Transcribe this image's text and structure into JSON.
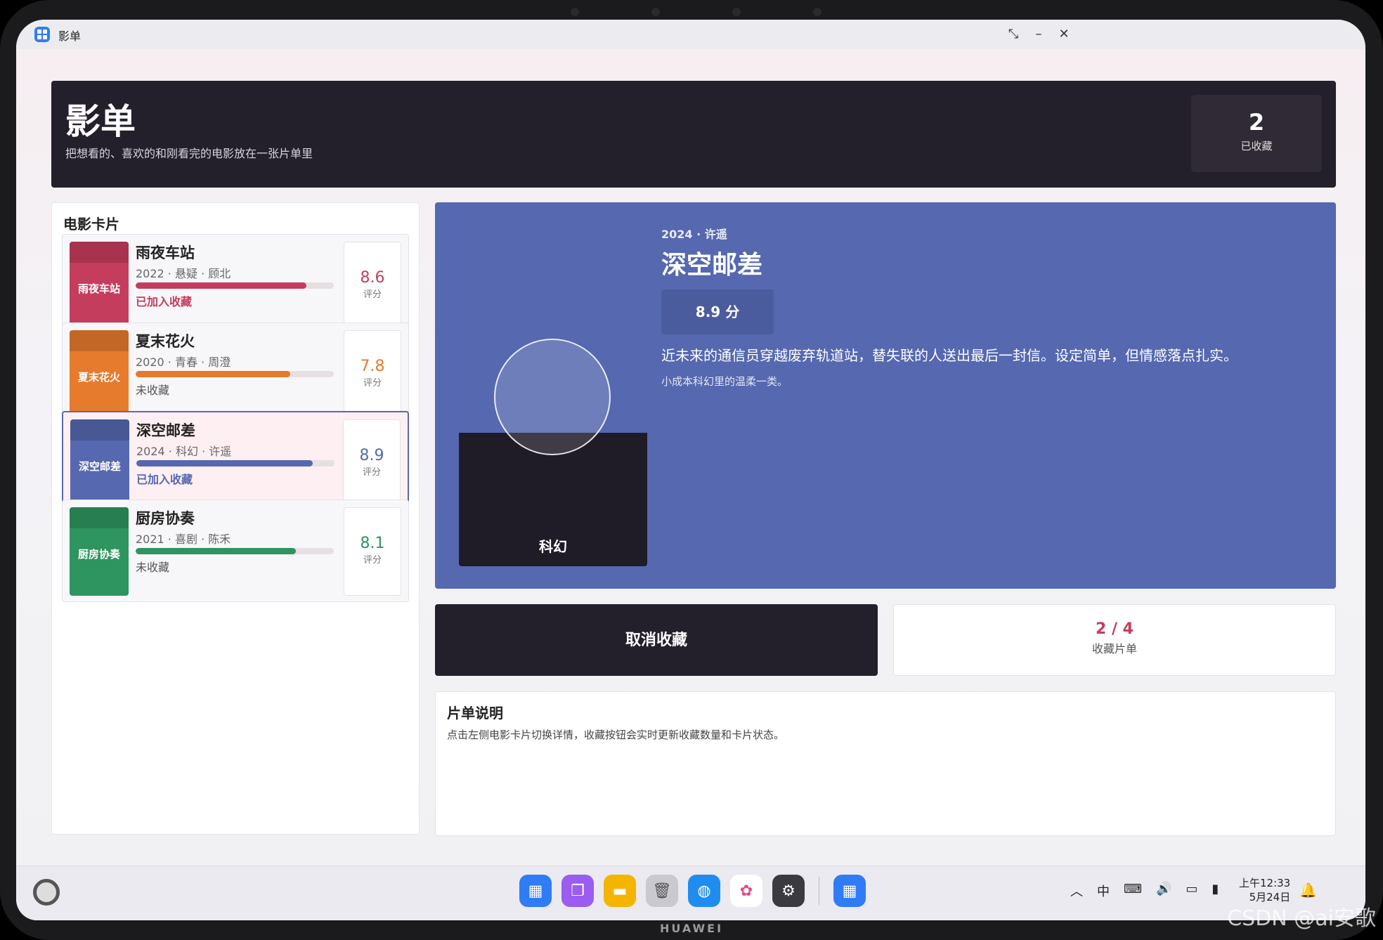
{
  "window": {
    "title": "影单"
  },
  "header": {
    "title": "影单",
    "subtitle": "把想看的、喜欢的和刚看完的电影放在一张片单里",
    "count": "2",
    "count_label": "已收藏"
  },
  "list": {
    "title": "电影卡片",
    "cards": [
      {
        "title": "雨夜车站",
        "meta": "2022 · 悬疑 · 顾北",
        "rating_fraction": 0.86,
        "status": "已加入收藏",
        "score": "8.6",
        "score_label": "评分",
        "color": "#c53d5d",
        "favored": true
      },
      {
        "title": "夏末花火",
        "meta": "2020 · 青春 · 周澄",
        "rating_fraction": 0.78,
        "status": "未收藏",
        "score": "7.8",
        "score_label": "评分",
        "color": "#e67a2d",
        "favored": false
      },
      {
        "title": "深空邮差",
        "meta": "2024 · 科幻 · 许遥",
        "rating_fraction": 0.89,
        "status": "已加入收藏",
        "score": "8.9",
        "score_label": "评分",
        "color": "#5568b0",
        "favored": true
      },
      {
        "title": "厨房协奏",
        "meta": "2021 · 喜剧 · 陈禾",
        "rating_fraction": 0.81,
        "status": "未收藏",
        "score": "8.1",
        "score_label": "评分",
        "color": "#2e9460",
        "favored": false
      }
    ]
  },
  "detail": {
    "meta": "2024 · 许遥",
    "title": "深空邮差",
    "score": "8.9 分",
    "genre": "科幻",
    "description": "近未来的通信员穿越废弃轨道站，替失联的人送出最后一封信。设定简单，但情感落点扎实。",
    "note": "小成本科幻里的温柔一类。",
    "color": "#5568b0"
  },
  "actions": {
    "unfavorite_label": "取消收藏",
    "count": "2 / 4",
    "count_label": "收藏片单"
  },
  "notes": {
    "title": "片单说明",
    "text": "点击左侧电影卡片切换详情，收藏按钮会实时更新收藏数量和卡片状态。"
  },
  "taskbar": {
    "time": "上午12:33",
    "date": "5月24日"
  },
  "device": {
    "brand": "HUAWEI",
    "watermark": "CSDN @ai安歌"
  }
}
